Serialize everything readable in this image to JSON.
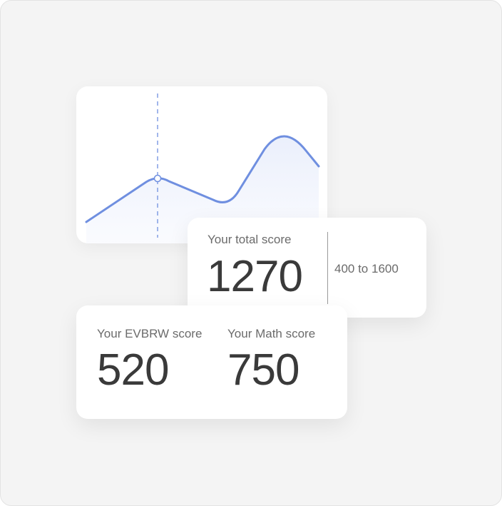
{
  "total": {
    "label": "Your total score",
    "value": "1270",
    "range": "400 to 1600"
  },
  "sections": [
    {
      "label": "Your EVBRW score",
      "value": "520"
    },
    {
      "label": "Your Math score",
      "value": "750"
    }
  ],
  "colors": {
    "background": "#f4f4f4",
    "card": "#ffffff",
    "line": "#6f8fe0",
    "text_primary": "#3a3a3a",
    "text_secondary": "#6b6b6b"
  }
}
